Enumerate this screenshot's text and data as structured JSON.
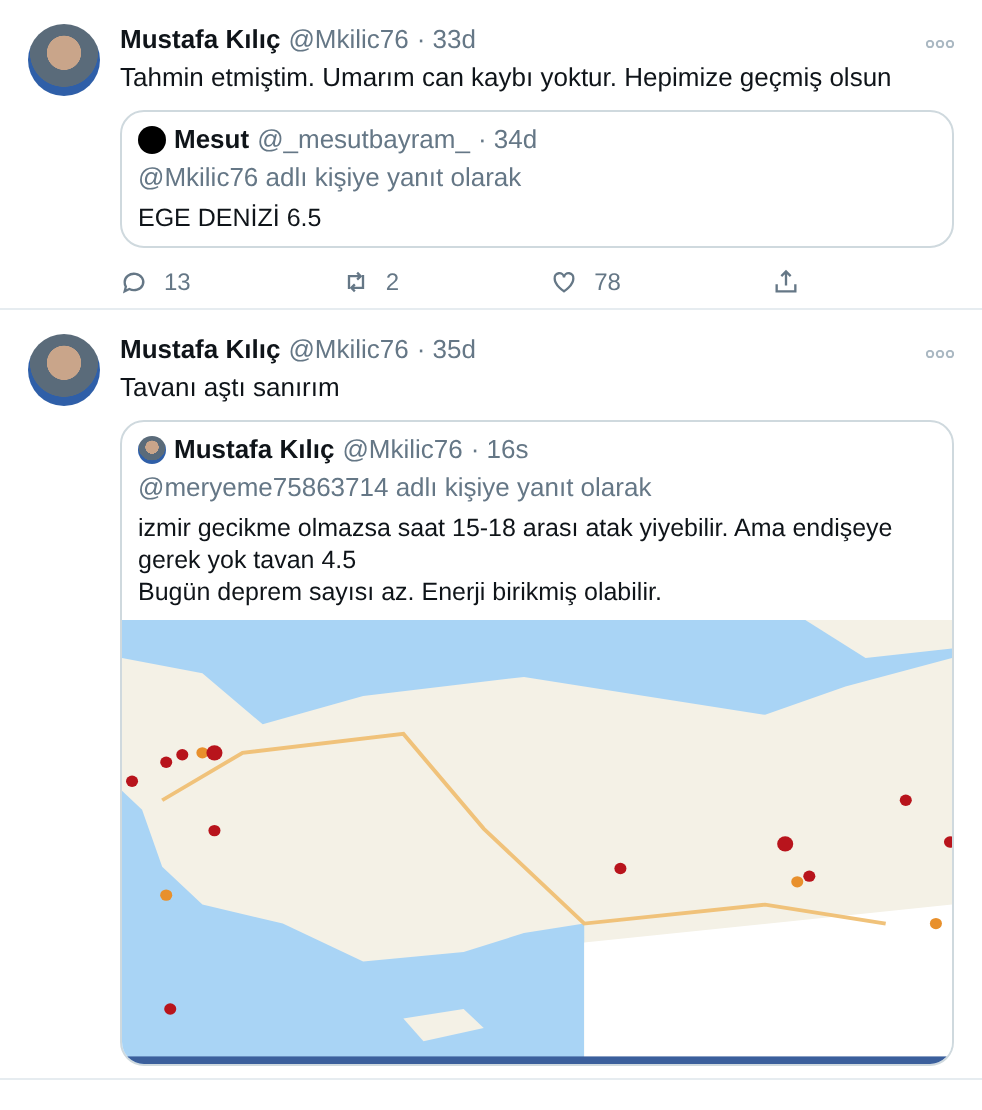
{
  "tweets": [
    {
      "author": "Mustafa Kılıç",
      "handle": "@Mkilic76",
      "time": "· 33d",
      "text": "Tahmin etmiştim. Umarım can kaybı yoktur. Hepimize geçmiş olsun",
      "quote": {
        "author": "Mesut",
        "handle": "@_mesutbayram_",
        "time": "· 34d",
        "avatar": {
          "kind": "dark"
        },
        "reply_to": "@Mkilic76 adlı kişiye yanıt olarak",
        "text": [
          "EGE DENİZİ 6.5"
        ]
      },
      "actions": {
        "replies": "13",
        "retweets": "2",
        "likes": "78"
      }
    },
    {
      "author": "Mustafa Kılıç",
      "handle": "@Mkilic76",
      "time": "· 35d",
      "text": "Tavanı aştı sanırım",
      "quote": {
        "author": "Mustafa Kılıç",
        "handle": "@Mkilic76",
        "time": "· 16s",
        "avatar": {
          "kind": "photo"
        },
        "reply_to": "@meryeme75863714 adlı kişiye yanıt olarak",
        "text": [
          "izmir gecikme olmazsa saat 15-18 arası atak yiyebilir. Ama endişeye gerek yok tavan 4.5",
          "Bugün deprem sayısı az. Enerji birikmiş olabilir."
        ],
        "media": [
          {
            "kind": "map"
          }
        ]
      }
    }
  ]
}
